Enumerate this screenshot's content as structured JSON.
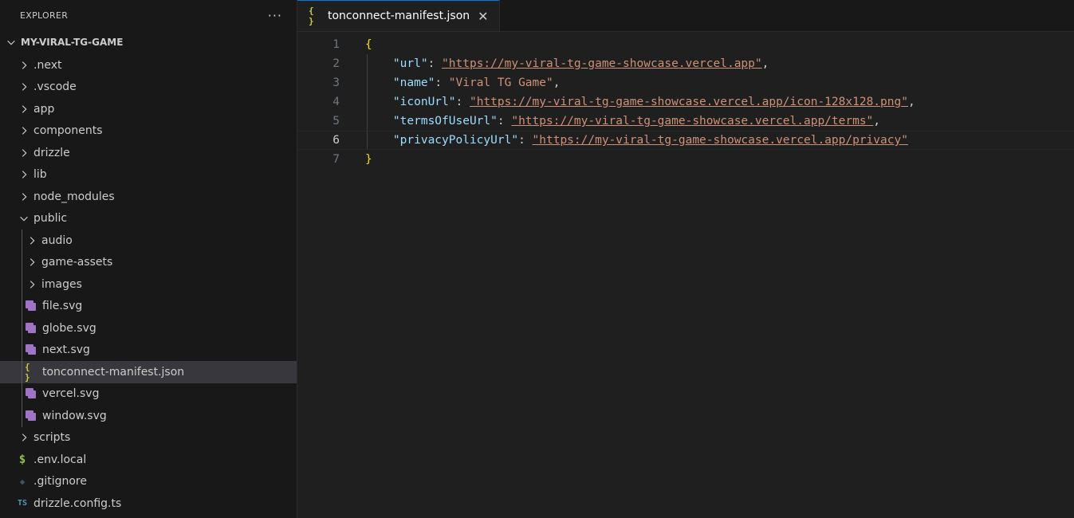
{
  "explorer": {
    "title": "EXPLORER",
    "more_label": "···",
    "root_label": "MY-VIRAL-TG-GAME",
    "items": [
      {
        "label": ".next"
      },
      {
        "label": ".vscode"
      },
      {
        "label": "app"
      },
      {
        "label": "components"
      },
      {
        "label": "drizzle"
      },
      {
        "label": "lib"
      },
      {
        "label": "node_modules"
      },
      {
        "label": "public"
      },
      {
        "label": "audio"
      },
      {
        "label": "game-assets"
      },
      {
        "label": "images"
      },
      {
        "label": "file.svg"
      },
      {
        "label": "globe.svg"
      },
      {
        "label": "next.svg"
      },
      {
        "label": "tonconnect-manifest.json"
      },
      {
        "label": "vercel.svg"
      },
      {
        "label": "window.svg"
      },
      {
        "label": "scripts"
      },
      {
        "label": ".env.local"
      },
      {
        "label": ".gitignore"
      },
      {
        "label": "drizzle.config.ts"
      }
    ]
  },
  "icons": {
    "json": "{ }",
    "env": "$",
    "git": "◆",
    "ts": "TS",
    "close": "✕"
  },
  "editor": {
    "tab_label": "tonconnect-manifest.json",
    "line_numbers": [
      "1",
      "2",
      "3",
      "4",
      "5",
      "6",
      "7"
    ],
    "open_brace": "{",
    "close_brace": "}",
    "entries": [
      {
        "key": "\"url\"",
        "value": "\"https://my-viral-tg-game-showcase.vercel.app\"",
        "trail": ","
      },
      {
        "key": "\"name\"",
        "value": "\"Viral TG Game\"",
        "trail": ","
      },
      {
        "key": "\"iconUrl\"",
        "value": "\"https://my-viral-tg-game-showcase.vercel.app/icon-128x128.png\"",
        "trail": ","
      },
      {
        "key": "\"termsOfUseUrl\"",
        "value": "\"https://my-viral-tg-game-showcase.vercel.app/terms\"",
        "trail": ","
      },
      {
        "key": "\"privacyPolicyUrl\"",
        "value": "\"https://my-viral-tg-game-showcase.vercel.app/privacy\"",
        "trail": ""
      }
    ]
  },
  "colors": {
    "key": "#9cdcfe",
    "string": "#ce9178",
    "brace": "#ffd700",
    "svg_icon": "#a074c4",
    "json_icon": "#cbcb41",
    "accent": "#0078d4"
  }
}
